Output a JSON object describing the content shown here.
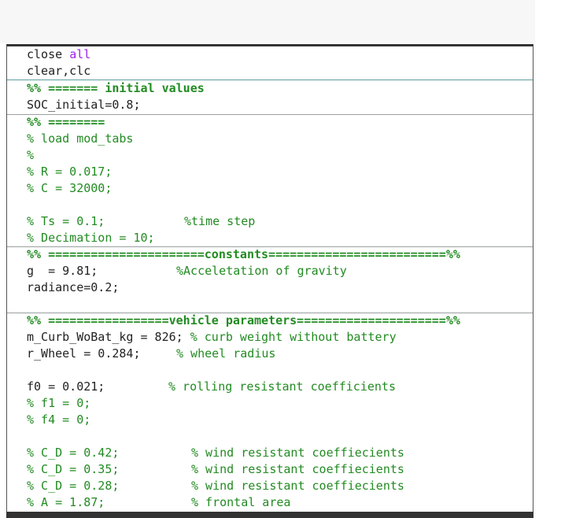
{
  "code": {
    "l01": {
      "a": "close ",
      "kw": "all"
    },
    "l02": "clear,clc",
    "l03": "%% ======= initial values",
    "l04": "SOC_initial=0.8;",
    "l05": "%% ========",
    "l06": "% load mod_tabs",
    "l07": "%",
    "l08": "% R = 0.017;",
    "l09": "% C = 32000;",
    "l10": {
      "a": "% Ts = 0.1;",
      "c": "%time step"
    },
    "l11": "% Decimation = 10;",
    "l12": "%% ======================constants=========================%%",
    "l13": {
      "a": "g  = 9.81;",
      "c": "%Acceletation of gravity"
    },
    "l14": "radiance=0.2;",
    "l15": "%% =================vehicle parameters=====================%%",
    "l16": {
      "a": "m_Curb_WoBat_kg = 826; ",
      "c": "% curb weight without battery"
    },
    "l17": {
      "a": "r_Wheel = 0.284;",
      "c": "% wheel radius"
    },
    "l18": {
      "a": "f0 = 0.021;",
      "c": "% rolling resistant coefficients"
    },
    "l19": "% f1 = 0;",
    "l20": "% f4 = 0;",
    "l21": {
      "a": "% C_D = 0.42;",
      "c": "% wind resistant coeffiecients"
    },
    "l22": {
      "a": "% C_D = 0.35;",
      "c": "% wind resistant coeffiecients"
    },
    "l23": {
      "a": "% C_D = 0.28;",
      "c": "% wind resistant coeffiecients"
    },
    "l24": {
      "a": "% A = 1.87;",
      "c": "% frontal area"
    }
  }
}
